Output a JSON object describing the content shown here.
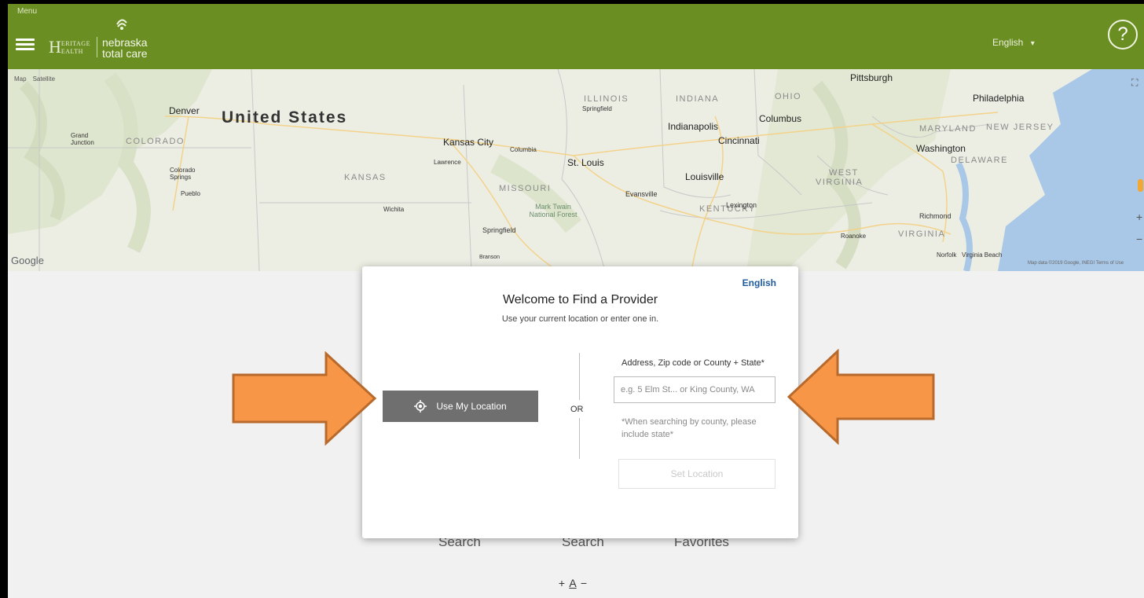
{
  "header": {
    "menu_label": "Menu",
    "logo_heritage_initial_h": "H",
    "logo_heritage_small_top": "ERITAGE",
    "logo_heritage_small_bottom": "EALTH",
    "logo_ntc_line1": "nebraska",
    "logo_ntc_line2": "total care",
    "language": "English",
    "language_chevron": "▾",
    "help_symbol": "?"
  },
  "map": {
    "type_controls": [
      "Map",
      "Satellite"
    ],
    "country": "United States",
    "states": [
      "COLORADO",
      "KANSAS",
      "MISSOURI",
      "ILLINOIS",
      "INDIANA",
      "OHIO",
      "KENTUCKY",
      "WEST",
      "VIRGINIA",
      "VIRGINIA",
      "MARYLAND",
      "NEW JERSEY",
      "DELAWARE"
    ],
    "cities": [
      "Denver",
      "Grand Junction",
      "Colorado Springs",
      "Pueblo",
      "Wichita",
      "Kansas City",
      "Lawrence",
      "Columbia",
      "Springfield",
      "St. Louis",
      "Mark Twain National Forest",
      "Springfield",
      "Evansville",
      "Indianapolis",
      "Cincinnati",
      "Louisville",
      "Lexington",
      "Columbus",
      "Pittsburgh",
      "Philadelphia",
      "Washington",
      "Richmond",
      "Roanoke",
      "Norfolk",
      "Virginia Beach",
      "Branson"
    ],
    "google": "Google",
    "attribution": "Map data ©2019 Google, INEGI   Terms of Use",
    "zoom_in": "+",
    "zoom_out": "−",
    "fullscreen": "⛶"
  },
  "bottom": {
    "buttons": [
      "Search",
      "Search",
      "Favorites"
    ],
    "font_plus": "+",
    "font_a": "A",
    "font_minus": "−"
  },
  "modal": {
    "language": "English",
    "title": "Welcome to Find a Provider",
    "subtitle": "Use your current location or enter one in.",
    "use_location": "Use My Location",
    "or": "OR",
    "address_label": "Address, Zip code or County + State*",
    "address_placeholder": "e.g. 5 Elm St... or King County, WA",
    "address_value": "",
    "county_note": "*When searching by county, please include state*",
    "set_location": "Set Location"
  },
  "colors": {
    "header": "#6b8e23",
    "arrow_fill": "#f79646",
    "arrow_stroke": "#b86a2c",
    "button_gray": "#6f6f6f",
    "link_blue": "#1e5a9c"
  }
}
